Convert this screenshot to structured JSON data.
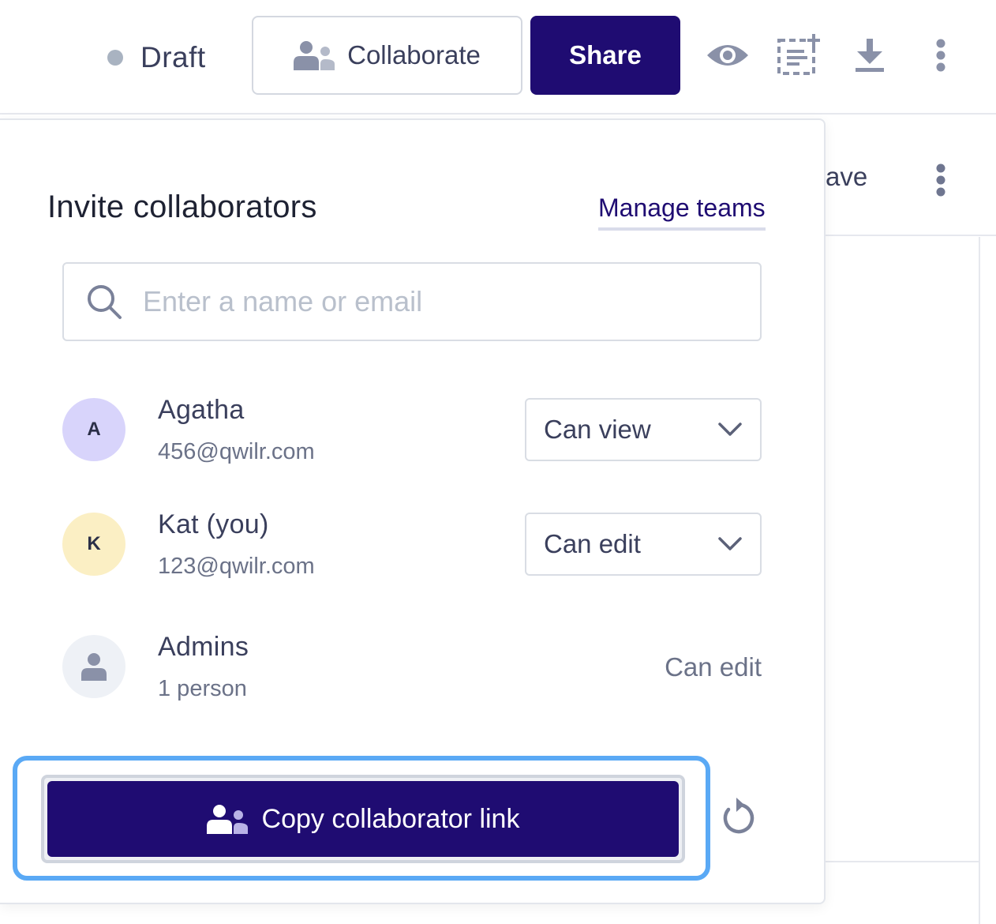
{
  "topbar": {
    "status": "Draft",
    "collaborate_label": "Collaborate",
    "share_label": "Share",
    "icons": [
      "eye-icon",
      "add-block-icon",
      "download-icon",
      "more-vertical-icon"
    ]
  },
  "background": {
    "save_partial": "ave"
  },
  "popover": {
    "title": "Invite collaborators",
    "manage_teams": "Manage teams",
    "search_placeholder": "Enter a name or email",
    "collaborators": [
      {
        "initial": "A",
        "name": "Agatha",
        "email": "456@qwilr.com",
        "permission": "Can view",
        "avatar_color": "#d8d4fb"
      },
      {
        "initial": "K",
        "name": "Kat (you)",
        "email": "123@qwilr.com",
        "permission": "Can edit",
        "avatar_color": "#fbefc4"
      },
      {
        "name": "Admins",
        "detail": "1 person",
        "permission": "Can edit",
        "avatar_color": "#eef1f6"
      }
    ],
    "copy_link_label": "Copy collaborator link"
  },
  "colors": {
    "brand": "#1f0c72",
    "focus_ring": "#5aa9f5"
  }
}
